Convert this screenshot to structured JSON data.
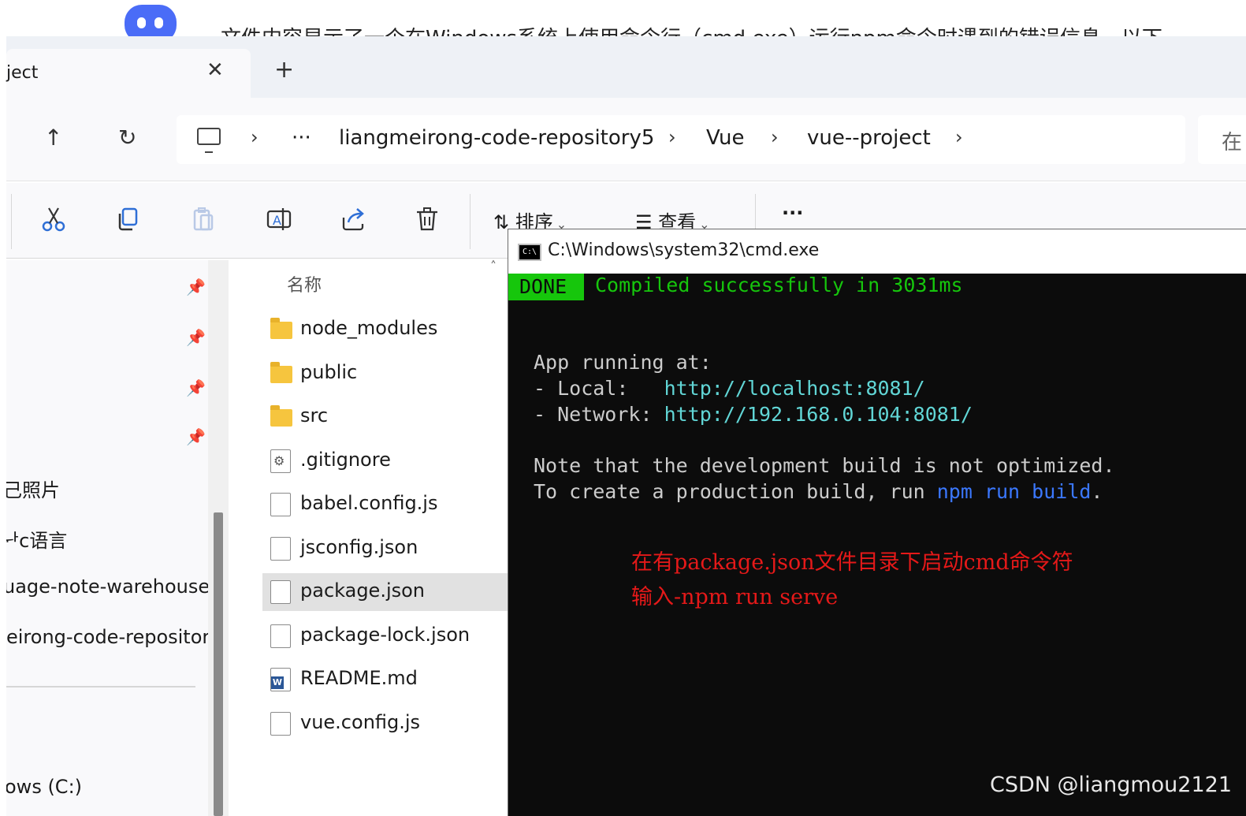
{
  "background": {
    "article_text": "文件内容显示了一个在Windows系统上使用命令行（cmd.exe）运行npm命令时遇到的错误信息。以下"
  },
  "tab": {
    "title": "ject",
    "close_label": "✕",
    "new_tab_label": "+"
  },
  "nav": {
    "up_label": "↑",
    "refresh_label": "↻",
    "more_label": "···",
    "breadcrumbs": [
      "liangmeirong-code-repository5",
      "Vue",
      "vue--project"
    ],
    "search_placeholder": "在"
  },
  "commandbar": {
    "sort_label": "排序",
    "view_label": "查看",
    "more_label": "···"
  },
  "navpane": {
    "items": [
      "己照片",
      "ᆉc语言",
      "uage-note-warehouse",
      "eirong-code-repository",
      "ows (C:)"
    ]
  },
  "filelist": {
    "column_name": "名称",
    "files": [
      {
        "name": "node_modules",
        "type": "folder"
      },
      {
        "name": "public",
        "type": "folder"
      },
      {
        "name": "src",
        "type": "folder"
      },
      {
        "name": ".gitignore",
        "type": "settings"
      },
      {
        "name": "babel.config.js",
        "type": "doc"
      },
      {
        "name": "jsconfig.json",
        "type": "doc"
      },
      {
        "name": "package.json",
        "type": "doc",
        "selected": true
      },
      {
        "name": "package-lock.json",
        "type": "doc"
      },
      {
        "name": "README.md",
        "type": "word"
      },
      {
        "name": "vue.config.js",
        "type": "doc"
      }
    ]
  },
  "cmd": {
    "title": "C:\\Windows\\system32\\cmd.exe",
    "icon_text": "C:\\",
    "done_label": "DONE",
    "compiled": "Compiled successfully in 3031ms",
    "app_running": "App running at:",
    "local_label": "- Local:   ",
    "local_url": "http://localhost:8081/",
    "network_label": "- Network: ",
    "network_url": "http://192.168.0.104:8081/",
    "note1": "Note that the development build is not optimized.",
    "note2_prefix": "To create a production build, run ",
    "note2_cmd": "npm run build",
    "note2_suffix": ".",
    "annotation_line1": "在有package.json文件目录下启动cmd命令符",
    "annotation_line2": "输入-npm run serve"
  },
  "watermark": "CSDN @liangmou2121",
  "colors": {
    "accent_blue": "#4a6cf7",
    "terminal_bg": "#0c0c0c",
    "terminal_green": "#16c60c",
    "terminal_blue": "#3b78ff",
    "annotation_red": "#e51919",
    "folder_yellow": "#f6c53e"
  }
}
